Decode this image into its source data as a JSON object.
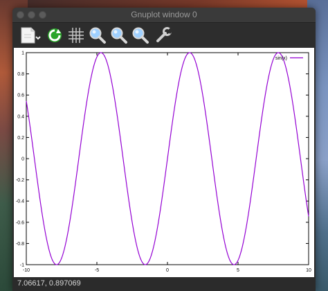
{
  "window": {
    "title": "Gnuplot window 0"
  },
  "toolbar": {
    "icons": [
      "export-icon",
      "replot-icon",
      "grid-icon",
      "zoom-previous-icon",
      "zoom-next-icon",
      "unzoom-icon",
      "settings-icon"
    ]
  },
  "status": {
    "coords": "7.06617,  0.897069"
  },
  "chart_data": {
    "type": "line",
    "function": "sin(x)",
    "xlim": [
      -10,
      10
    ],
    "ylim": [
      -1,
      1
    ],
    "xticks": [
      -10,
      -5,
      0,
      5,
      10
    ],
    "xtick_labels": [
      "-10",
      "-5",
      "0",
      "5",
      "10"
    ],
    "yticks": [
      -1,
      -0.8,
      -0.6,
      -0.4,
      -0.2,
      0,
      0.2,
      0.4,
      0.6,
      0.8,
      1
    ],
    "ytick_labels": [
      "-1",
      "-0.8",
      "-0.6",
      "-0.4",
      "-0.2",
      "0",
      "0.2",
      "0.4",
      "0.6",
      "0.8",
      "1"
    ],
    "grid": false,
    "legend_position": "top-right",
    "series": [
      {
        "name": "sin(x)",
        "color": "#9400d3",
        "samples": 101
      }
    ]
  }
}
